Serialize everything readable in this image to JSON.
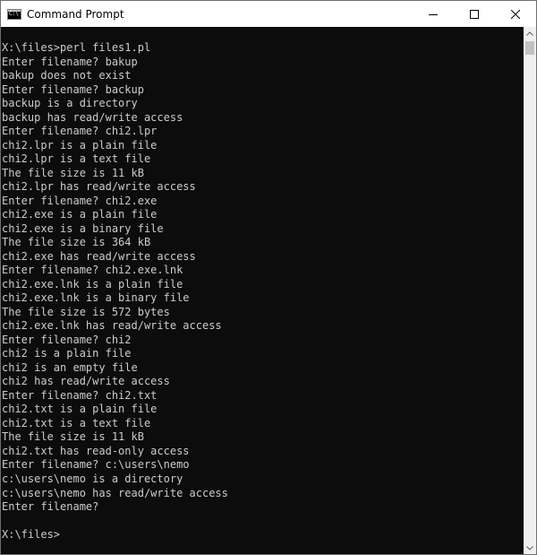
{
  "window": {
    "title": "Command Prompt"
  },
  "console": {
    "lines": [
      "X:\\files>perl files1.pl",
      "Enter filename? bakup",
      "bakup does not exist",
      "Enter filename? backup",
      "backup is a directory",
      "backup has read/write access",
      "Enter filename? chi2.lpr",
      "chi2.lpr is a plain file",
      "chi2.lpr is a text file",
      "The file size is 11 kB",
      "chi2.lpr has read/write access",
      "Enter filename? chi2.exe",
      "chi2.exe is a plain file",
      "chi2.exe is a binary file",
      "The file size is 364 kB",
      "chi2.exe has read/write access",
      "Enter filename? chi2.exe.lnk",
      "chi2.exe.lnk is a plain file",
      "chi2.exe.lnk is a binary file",
      "The file size is 572 bytes",
      "chi2.exe.lnk has read/write access",
      "Enter filename? chi2",
      "chi2 is a plain file",
      "chi2 is an empty file",
      "chi2 has read/write access",
      "Enter filename? chi2.txt",
      "chi2.txt is a plain file",
      "chi2.txt is a text file",
      "The file size is 11 kB",
      "chi2.txt has read-only access",
      "Enter filename? c:\\users\\nemo",
      "c:\\users\\nemo is a directory",
      "c:\\users\\nemo has read/write access",
      "Enter filename?",
      "",
      "X:\\files>"
    ]
  },
  "icons": {
    "app": "command-prompt-icon",
    "minimize": "minimize-icon",
    "maximize": "maximize-icon",
    "close": "close-icon",
    "scroll_up": "scroll-up-arrow-icon",
    "scroll_down": "scroll-down-arrow-icon"
  },
  "colors": {
    "console_background": "#0c0c0c",
    "console_text": "#cccccc",
    "titlebar_background": "#ffffff"
  }
}
